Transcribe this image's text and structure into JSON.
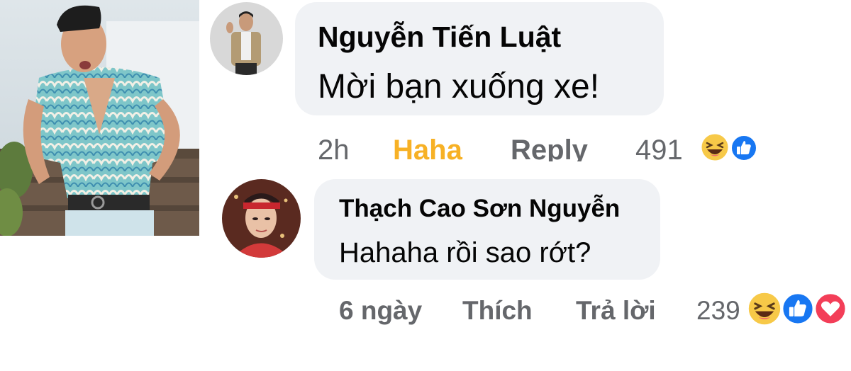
{
  "comments": [
    {
      "author": "Nguyễn Tiến Luật",
      "text": "Mời bạn xuống xe!",
      "time": "2h",
      "reaction_label": "Haha",
      "reply_label": "Reply",
      "reaction_count": "491",
      "reaction_icons": [
        "haha-icon",
        "like-icon"
      ]
    },
    {
      "author": "Thạch Cao Sơn Nguyễn",
      "text": "Hahaha rồi sao rớt?",
      "time": "6 ngày",
      "like_label": "Thích",
      "reply_label": "Trả lời",
      "reaction_count": "239",
      "reaction_icons": [
        "haha-icon",
        "like-icon",
        "love-icon"
      ]
    }
  ],
  "colors": {
    "bubble_bg": "#f0f2f5",
    "haha_active": "#f7b125",
    "muted_text": "#65676b",
    "like_blue": "#1877f2",
    "love_red": "#f33e58"
  }
}
